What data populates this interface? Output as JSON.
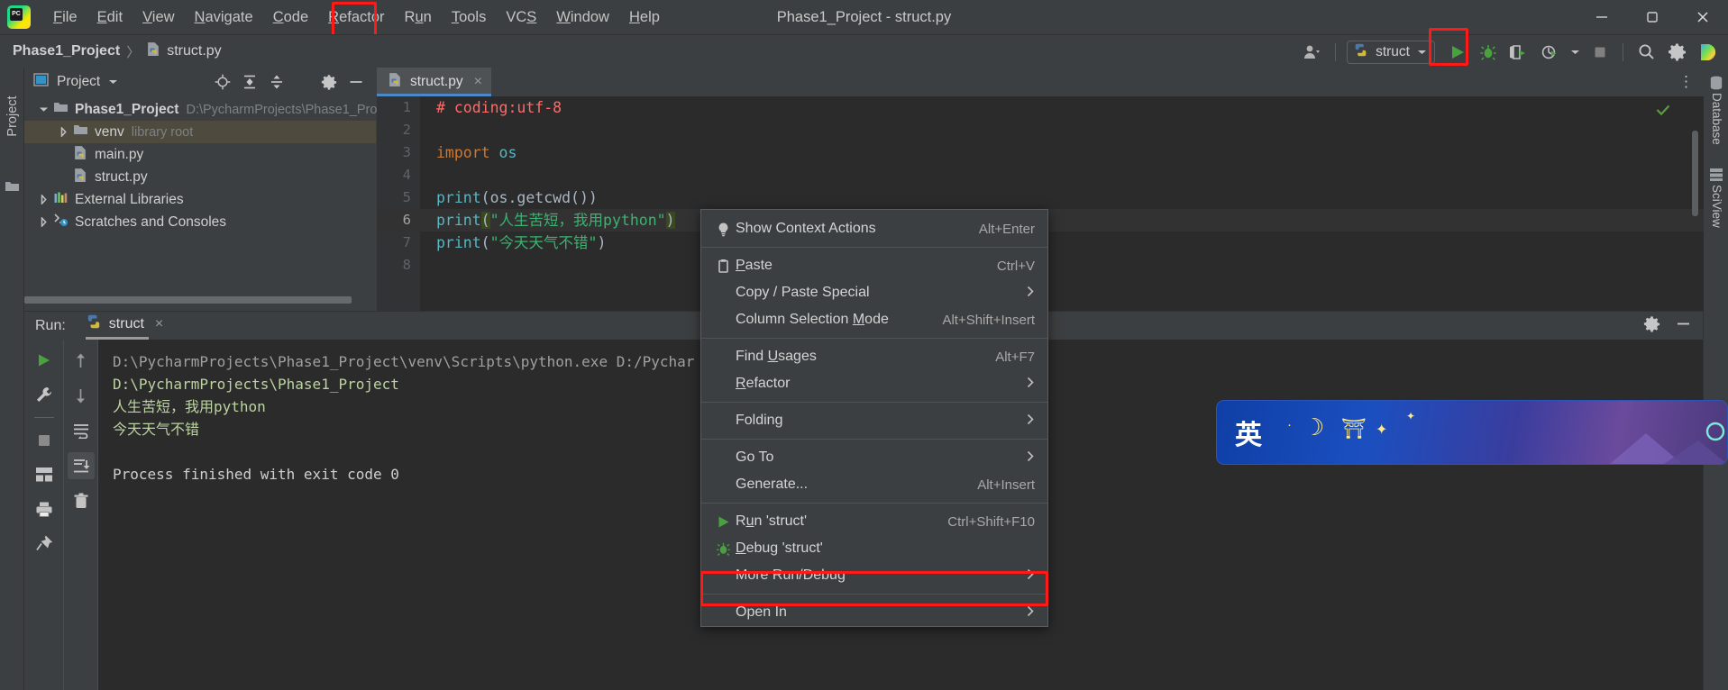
{
  "window": {
    "title": "Phase1_Project - struct.py",
    "controls": [
      "minimize",
      "maximize",
      "close"
    ]
  },
  "menubar": {
    "logo": "pycharm-logo",
    "items": [
      {
        "label": "File",
        "mnemonic": "F"
      },
      {
        "label": "Edit",
        "mnemonic": "E"
      },
      {
        "label": "View",
        "mnemonic": "V"
      },
      {
        "label": "Navigate",
        "mnemonic": "N"
      },
      {
        "label": "Code",
        "mnemonic": "C"
      },
      {
        "label": "Refactor",
        "mnemonic": "R"
      },
      {
        "label": "Run",
        "mnemonic": "R",
        "highlighted": true
      },
      {
        "label": "Tools",
        "mnemonic": "T"
      },
      {
        "label": "VCS",
        "mnemonic": "S"
      },
      {
        "label": "Window",
        "mnemonic": "W"
      },
      {
        "label": "Help",
        "mnemonic": "H"
      }
    ]
  },
  "navbar": {
    "breadcrumb": {
      "project": "Phase1_Project",
      "separator": "〉",
      "file": "struct.py"
    },
    "run_configuration": "struct",
    "icons": [
      "user-icon",
      "run-icon",
      "debug-icon",
      "coverage-icon",
      "profile-icon",
      "stop-icon",
      "search-icon",
      "settings-icon",
      "ide-assistant-icon"
    ]
  },
  "left_stripe": {
    "label": "Project",
    "icon": "folder-icon"
  },
  "right_stripe": {
    "items": [
      "Database",
      "SciView"
    ]
  },
  "project_panel": {
    "title": "Project",
    "tools": [
      "locate-icon",
      "expand-all-icon",
      "collapse-all-icon",
      "settings-icon",
      "hide-icon"
    ],
    "tree": [
      {
        "label": "Phase1_Project",
        "sub": "D:\\PycharmProjects\\Phase1_Pro",
        "icon": "folder-icon",
        "twisty": "open",
        "depth": 0,
        "bold": true,
        "selected": false
      },
      {
        "label": "venv",
        "sub": "library root",
        "icon": "folder-icon",
        "twisty": "closed",
        "depth": 1,
        "bold": false,
        "selected": true
      },
      {
        "label": "main.py",
        "sub": "",
        "icon": "python-file-icon",
        "twisty": "none",
        "depth": 2,
        "bold": false,
        "selected": false
      },
      {
        "label": "struct.py",
        "sub": "",
        "icon": "python-file-icon",
        "twisty": "none",
        "depth": 2,
        "bold": false,
        "selected": false
      },
      {
        "label": "External Libraries",
        "sub": "",
        "icon": "libraries-icon",
        "twisty": "closed",
        "depth": 0,
        "bold": false,
        "selected": false
      },
      {
        "label": "Scratches and Consoles",
        "sub": "",
        "icon": "scratches-icon",
        "twisty": "closed",
        "depth": 0,
        "bold": false,
        "selected": false
      }
    ]
  },
  "editor": {
    "tab": {
      "label": "struct.py",
      "icon": "python-file-icon",
      "close": "×"
    },
    "kebab": "⋮",
    "inspection_status": "ok-check-icon",
    "lines": [
      {
        "no": "1",
        "current": false,
        "tokens": [
          {
            "t": "# coding:utf-8",
            "c": "c-comment"
          }
        ]
      },
      {
        "no": "2",
        "current": false,
        "tokens": []
      },
      {
        "no": "3",
        "current": false,
        "tokens": [
          {
            "t": "import",
            "c": "c-kw"
          },
          {
            "t": " ",
            "c": "c-ident"
          },
          {
            "t": "os",
            "c": "c-fn"
          }
        ]
      },
      {
        "no": "4",
        "current": false,
        "tokens": []
      },
      {
        "no": "5",
        "current": false,
        "tokens": [
          {
            "t": "print",
            "c": "c-fn"
          },
          {
            "t": "(",
            "c": "c-paren"
          },
          {
            "t": "os",
            "c": "c-ident"
          },
          {
            "t": ".",
            "c": "c-paren"
          },
          {
            "t": "getcwd",
            "c": "c-ident"
          },
          {
            "t": "())",
            "c": "c-paren"
          }
        ]
      },
      {
        "no": "6",
        "current": true,
        "tokens": [
          {
            "t": "print",
            "c": "c-fn"
          },
          {
            "t": "(",
            "c": "c-paren c-match"
          },
          {
            "t": "\"人生苦短，我用python\"",
            "c": "c-str"
          },
          {
            "t": ")",
            "c": "c-paren c-match"
          }
        ]
      },
      {
        "no": "7",
        "current": false,
        "tokens": [
          {
            "t": "print",
            "c": "c-fn"
          },
          {
            "t": "(",
            "c": "c-paren"
          },
          {
            "t": "\"今天天气不错\"",
            "c": "c-str"
          },
          {
            "t": ")",
            "c": "c-paren"
          }
        ]
      },
      {
        "no": "8",
        "current": false,
        "tokens": []
      }
    ]
  },
  "run_panel": {
    "label": "Run:",
    "tab": {
      "label": "struct",
      "icon": "python-icon",
      "close": "×"
    },
    "header_icons": [
      "settings-icon",
      "hide-icon"
    ],
    "toolbar_left": [
      "rerun-icon",
      "wrench-icon",
      "stop-icon",
      "layout-icon",
      "print-icon",
      "pin-icon"
    ],
    "toolbar_mid": [
      "up-icon",
      "down-icon",
      "soft-wrap-icon",
      "scroll-to-end-icon",
      "trash-icon"
    ],
    "console_lines": [
      {
        "text": "D:\\PycharmProjects\\Phase1_Project\\venv\\Scripts\\python.exe D:/Pychar",
        "style": "gray"
      },
      {
        "text": "D:\\PycharmProjects\\Phase1_Project",
        "style": "green"
      },
      {
        "text": "人生苦短，我用python",
        "style": "green"
      },
      {
        "text": "今天天气不错",
        "style": "green"
      },
      {
        "text": "",
        "style": "spacer"
      },
      {
        "text": "Process finished with exit code 0",
        "style": "out"
      }
    ]
  },
  "context_menu": {
    "items": [
      {
        "type": "item",
        "label": "Show Context Actions",
        "shortcut": "Alt+Enter",
        "icon": "lightbulb-icon",
        "mnemonic": "",
        "arrow": false
      },
      {
        "type": "sep"
      },
      {
        "type": "item",
        "label": "Paste",
        "shortcut": "Ctrl+V",
        "icon": "clipboard-icon",
        "mnemonic": "P",
        "arrow": false
      },
      {
        "type": "item",
        "label": "Copy / Paste Special",
        "shortcut": "",
        "icon": "",
        "mnemonic": "",
        "arrow": true
      },
      {
        "type": "item",
        "label": "Column Selection Mode",
        "shortcut": "Alt+Shift+Insert",
        "icon": "",
        "mnemonic": "M",
        "arrow": false
      },
      {
        "type": "sep"
      },
      {
        "type": "item",
        "label": "Find Usages",
        "shortcut": "Alt+F7",
        "icon": "",
        "mnemonic": "U",
        "arrow": false
      },
      {
        "type": "item",
        "label": "Refactor",
        "shortcut": "",
        "icon": "",
        "mnemonic": "R",
        "arrow": true
      },
      {
        "type": "sep"
      },
      {
        "type": "item",
        "label": "Folding",
        "shortcut": "",
        "icon": "",
        "mnemonic": "",
        "arrow": true
      },
      {
        "type": "sep"
      },
      {
        "type": "item",
        "label": "Go To",
        "shortcut": "",
        "icon": "",
        "mnemonic": "",
        "arrow": true
      },
      {
        "type": "item",
        "label": "Generate...",
        "shortcut": "Alt+Insert",
        "icon": "",
        "mnemonic": "",
        "arrow": false
      },
      {
        "type": "sep"
      },
      {
        "type": "item",
        "label": "Run 'struct'",
        "shortcut": "Ctrl+Shift+F10",
        "icon": "run-icon",
        "mnemonic": "u",
        "arrow": false,
        "highlighted": true
      },
      {
        "type": "item",
        "label": "Debug 'struct'",
        "shortcut": "",
        "icon": "debug-icon",
        "mnemonic": "D",
        "arrow": false
      },
      {
        "type": "item",
        "label": "More Run/Debug",
        "shortcut": "",
        "icon": "",
        "mnemonic": "",
        "arrow": true
      },
      {
        "type": "sep"
      },
      {
        "type": "item",
        "label": "Open In",
        "shortcut": "",
        "icon": "",
        "mnemonic": "",
        "arrow": true
      }
    ]
  },
  "float_widget": {
    "char": "英",
    "decorations": [
      "moon-icon",
      "star-icon",
      "lamp-icon"
    ]
  },
  "colors": {
    "accent_red": "#ff1a17",
    "run_green": "#4a9f41",
    "panel_bg": "#3c3f41",
    "editor_bg": "#2b2b2b",
    "tab_active": "#4e5254",
    "selection": "#4e4a3e",
    "tab_underline": "#4a88c7"
  }
}
